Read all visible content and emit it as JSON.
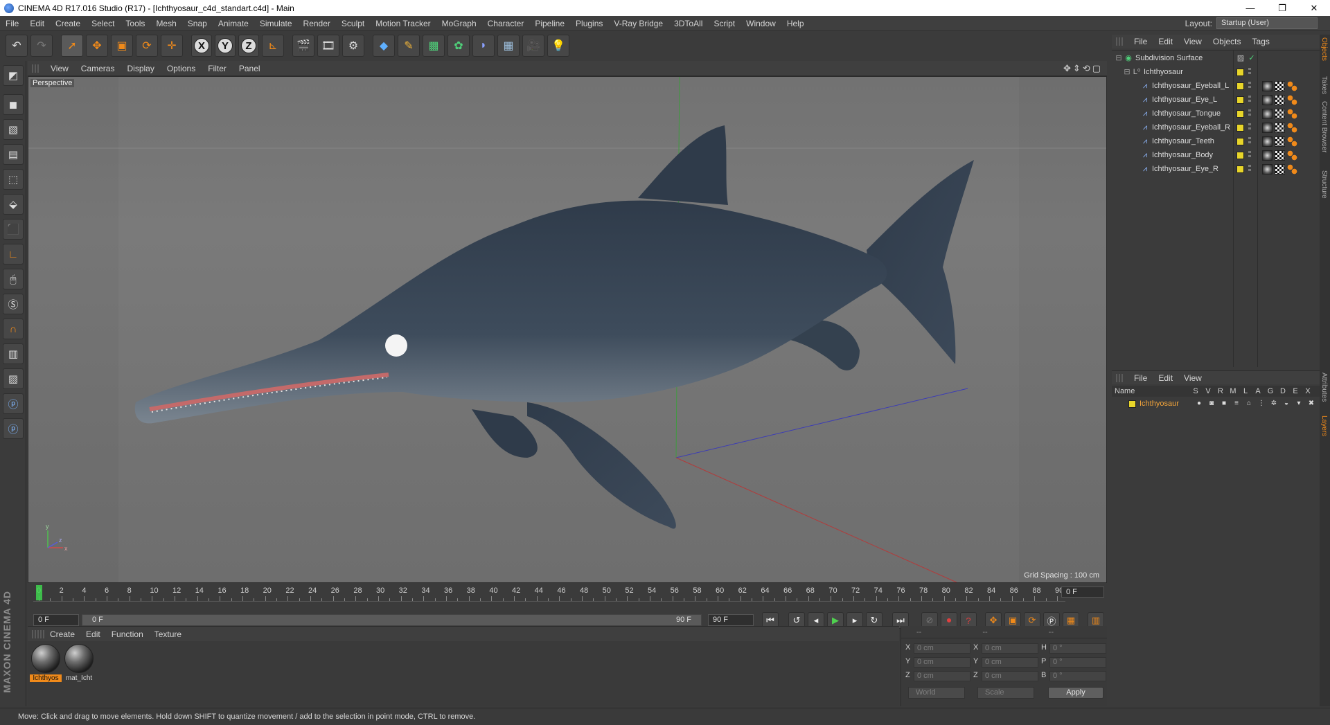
{
  "window": {
    "title": "CINEMA 4D R17.016 Studio (R17) - [Ichthyosaur_c4d_standart.c4d] - Main",
    "controls": [
      "—",
      "❐",
      "✕"
    ]
  },
  "menubar": {
    "items": [
      "File",
      "Edit",
      "Create",
      "Select",
      "Tools",
      "Mesh",
      "Snap",
      "Animate",
      "Simulate",
      "Render",
      "Sculpt",
      "Motion Tracker",
      "MoGraph",
      "Character",
      "Pipeline",
      "Plugins",
      "V-Ray Bridge",
      "3DToAll",
      "Script",
      "Window",
      "Help"
    ],
    "layout_label": "Layout:",
    "layout_value": "Startup (User)"
  },
  "toolbar": {
    "axis": [
      "X",
      "Y",
      "Z"
    ]
  },
  "viewport": {
    "menu": [
      "View",
      "Cameras",
      "Display",
      "Options",
      "Filter",
      "Panel"
    ],
    "camera_label": "Perspective",
    "grid_spacing": "Grid Spacing : 100 cm",
    "nav_icons": "✥⇕⟲▢",
    "axis_x": "x",
    "axis_y": "y",
    "axis_z": "z"
  },
  "timeline": {
    "ticks": [
      "0",
      "2",
      "4",
      "6",
      "8",
      "10",
      "12",
      "14",
      "16",
      "18",
      "20",
      "22",
      "24",
      "26",
      "28",
      "30",
      "32",
      "34",
      "36",
      "38",
      "40",
      "42",
      "44",
      "46",
      "48",
      "50",
      "52",
      "54",
      "56",
      "58",
      "60",
      "62",
      "64",
      "66",
      "68",
      "70",
      "72",
      "74",
      "76",
      "78",
      "80",
      "82",
      "84",
      "86",
      "88",
      "90"
    ],
    "current_frame": "0 F",
    "start_field": "0 F",
    "slider_start": "0 F",
    "slider_end": "90 F",
    "end_field": "90 F"
  },
  "materials": {
    "menu": [
      "Create",
      "Edit",
      "Function",
      "Texture"
    ],
    "items": [
      {
        "name": "Ichthyos",
        "selected": true
      },
      {
        "name": "mat_Icht",
        "selected": false
      }
    ]
  },
  "coordinates": {
    "header": [
      "--",
      "--",
      "--"
    ],
    "rows": [
      {
        "a1": "X",
        "v1": "0 cm",
        "a2": "X",
        "v2": "0 cm",
        "a3": "H",
        "v3": "0 °"
      },
      {
        "a1": "Y",
        "v1": "0 cm",
        "a2": "Y",
        "v2": "0 cm",
        "a3": "P",
        "v3": "0 °"
      },
      {
        "a1": "Z",
        "v1": "0 cm",
        "a2": "Z",
        "v2": "0 cm",
        "a3": "B",
        "v3": "0 °"
      }
    ],
    "space": "World",
    "mode": "Scale",
    "apply": "Apply"
  },
  "status": {
    "text": "Move: Click and drag to move elements. Hold down SHIFT to quantize movement / add to the selection in point mode, CTRL to remove."
  },
  "object_manager": {
    "menu": [
      "File",
      "Edit",
      "View",
      "Objects",
      "Tags"
    ],
    "objects": [
      {
        "name": "Subdivision Surface",
        "level": 0
      },
      {
        "name": "Ichthyosaur",
        "level": 1
      },
      {
        "name": "Ichthyosaur_Eyeball_L",
        "level": 2
      },
      {
        "name": "Ichthyosaur_Eye_L",
        "level": 2
      },
      {
        "name": "Ichthyosaur_Tongue",
        "level": 2
      },
      {
        "name": "Ichthyosaur_Eyeball_R",
        "level": 2
      },
      {
        "name": "Ichthyosaur_Teeth",
        "level": 2
      },
      {
        "name": "Ichthyosaur_Body",
        "level": 2
      },
      {
        "name": "Ichthyosaur_Eye_R",
        "level": 2
      }
    ]
  },
  "side_tabs": [
    "Objects",
    "Takes",
    "Content Browser",
    "Structure",
    "Attributes",
    "Layers"
  ],
  "layer_manager": {
    "menu": [
      "File",
      "Edit",
      "View"
    ],
    "name_header": "Name",
    "flag_headers": [
      "S",
      "V",
      "R",
      "M",
      "L",
      "A",
      "G",
      "D",
      "E",
      "X"
    ],
    "layers": [
      {
        "name": "Ichthyosaur",
        "color": "#e8d52a"
      }
    ]
  },
  "brand": "MAXON CINEMA 4D",
  "colors": {
    "accent": "#f08a1a",
    "layer_yellow": "#e8d52a",
    "creature": "#3e4c5c"
  }
}
